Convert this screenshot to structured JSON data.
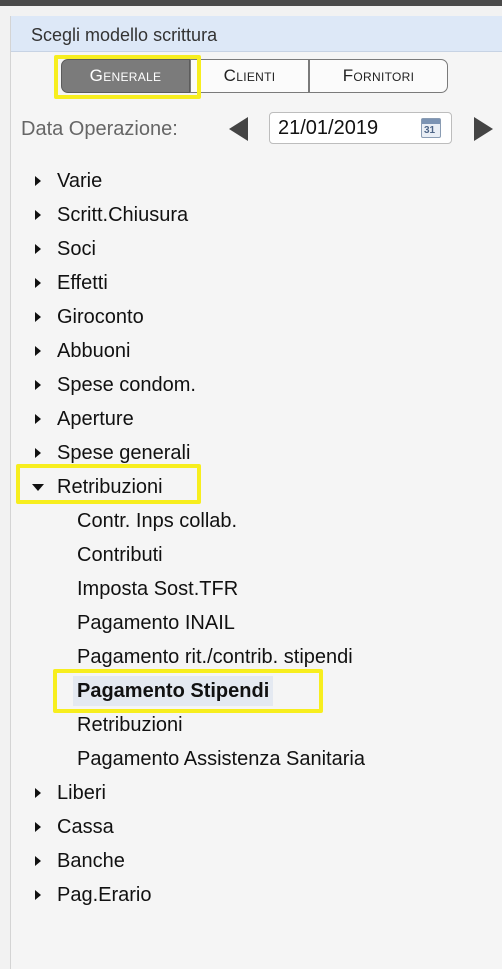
{
  "panel": {
    "title": "Scegli modello scrittura"
  },
  "segments": [
    {
      "label": "Generale",
      "active": true
    },
    {
      "label": "Clienti",
      "active": false
    },
    {
      "label": "Fornitori",
      "active": false
    }
  ],
  "date": {
    "label": "Data Operazione:",
    "value": "21/01/2019",
    "calendar_day": "31"
  },
  "tree": {
    "groups_before": [
      "Varie",
      "Scritt.Chiusura",
      "Soci",
      "Effetti",
      "Giroconto",
      "Abbuoni",
      "Spese condom.",
      "Aperture",
      "Spese generali"
    ],
    "expanded": {
      "label": "Retribuzioni",
      "children": [
        "Contr. Inps collab.",
        "Contributi",
        "Imposta Sost.TFR",
        "Pagamento INAIL",
        "Pagamento rit./contrib. stipendi",
        "Pagamento Stipendi",
        "Retribuzioni",
        "Pagamento Assistenza Sanitaria"
      ],
      "selected_index": 5
    },
    "groups_after": [
      "Liberi",
      "Cassa",
      "Banche",
      "Pag.Erario"
    ]
  },
  "colors": {
    "highlight": "#f7ee1e",
    "active_segment": "#7b7b7b",
    "title_bg": "#dde8f7"
  }
}
